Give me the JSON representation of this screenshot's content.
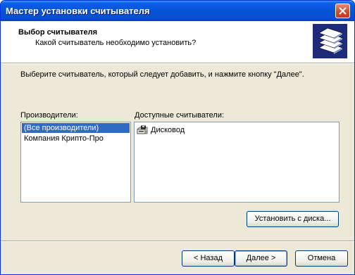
{
  "window": {
    "title": "Мастер установки считывателя"
  },
  "header": {
    "title": "Выбор считывателя",
    "subtitle": "Какой считыватель необходимо установить?",
    "icon": "smart-card-reader-stack-icon"
  },
  "instruction": "Выберите считыватель, который следует добавить, и нажмите кнопку \"Далее\".",
  "vendors": {
    "label": "Производители:",
    "items": [
      "(Все производители)",
      "Компания Крипто-Про"
    ],
    "selected_index": 0
  },
  "readers": {
    "label": "Доступные считыватели:",
    "items": [
      {
        "label": "Дисковод",
        "icon": "floppy-drive-icon"
      }
    ]
  },
  "buttons": {
    "install_from_disk": "Установить с диска...",
    "back": "< Назад",
    "next": "Далее >",
    "cancel": "Отмена"
  },
  "colors": {
    "titlebar": "#0454d6",
    "selection": "#316ac5",
    "dialog_bg": "#ece9d8"
  }
}
